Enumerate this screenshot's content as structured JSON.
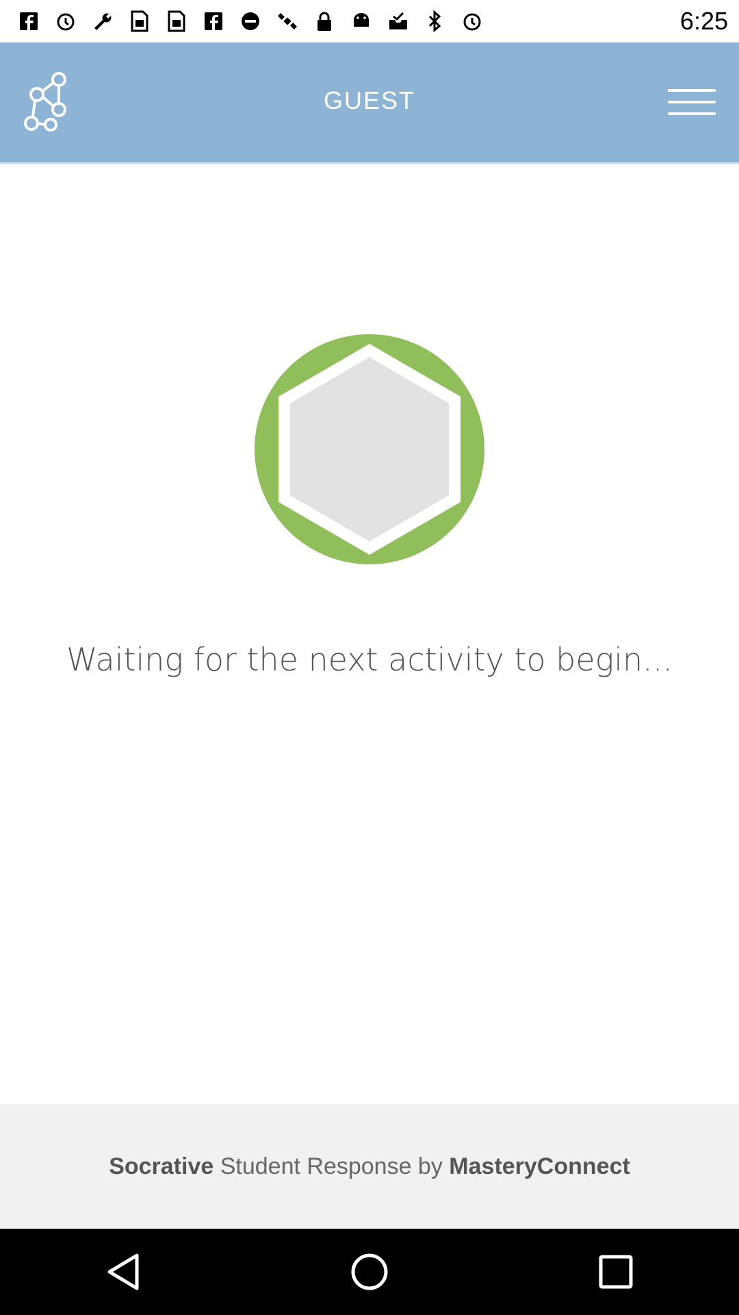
{
  "status_bar": {
    "time": "6:25",
    "icons": [
      "facebook-icon",
      "alarm-icon",
      "wrench-icon",
      "sim-card-icon",
      "sim-card-icon",
      "facebook-icon",
      "do-not-disturb-icon",
      "satellite-icon",
      "lock-icon",
      "android-icon",
      "inbox-check-icon",
      "bluetooth-icon",
      "alarm-icon"
    ]
  },
  "app_bar": {
    "title": "GUEST",
    "logo_icon": "network-hexagon-icon",
    "menu_icon": "hamburger-menu-icon"
  },
  "main": {
    "badge_icon": "hexagon-badge-icon",
    "message": "Waiting for the next activity to begin..."
  },
  "footer": {
    "brand": "Socrative",
    "middle": "Student Response by",
    "company": "MasteryConnect"
  },
  "nav_bar": {
    "buttons": [
      "back-icon",
      "home-icon",
      "recents-icon"
    ]
  },
  "colors": {
    "app_bar": "#8db3d5",
    "badge_ring": "#8fbe5b",
    "badge_fill": "#e2e2e2",
    "footer_bg": "#f1f1f1"
  }
}
